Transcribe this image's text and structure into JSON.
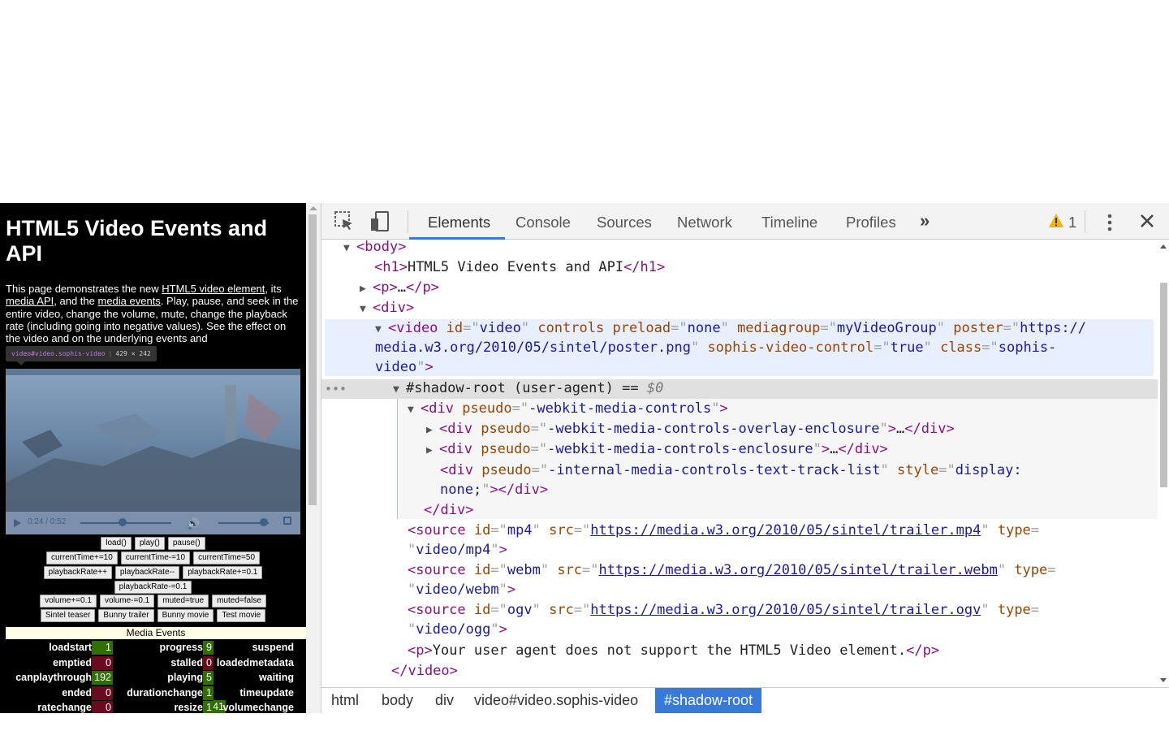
{
  "page": {
    "title": "HTML5 Video Events and API",
    "intro": {
      "t1": "This page demonstrates the new ",
      "link1": "HTML5 video element",
      "t2": ", its ",
      "link2": "media API",
      "t3": ", and the ",
      "link3": "media events",
      "t4": ". Play, pause, and seek in the entire video, change the volume, mute, change the playback rate (including going into negative values). See the effect on the video and on the underlying events and"
    },
    "tooltip": {
      "tag": "video#video.sophis-video",
      "size": "429 × 242"
    },
    "video": {
      "time": "0:24 / 0:52",
      "progress": 0.46,
      "volume": 0.9
    },
    "button_rows": [
      [
        "load()",
        "play()",
        "pause()"
      ],
      [
        "currentTime+=10",
        "currentTime-=10",
        "currentTime=50"
      ],
      [
        "playbackRate++",
        "playbackRate--",
        "playbackRate+=0.1"
      ],
      [
        "playbackRate-=0.1"
      ],
      [
        "volume+=0.1",
        "volume-=0.1",
        "muted=true",
        "muted=false"
      ],
      [
        "Sintel teaser",
        "Bunny trailer",
        "Bunny movie",
        "Test movie"
      ]
    ],
    "events_title": "Media Events",
    "events": [
      [
        {
          "name": "loadstart",
          "count": "1",
          "color": "#2f6f00"
        },
        {
          "name": "progress",
          "count": "9",
          "color": "#2f6f00"
        },
        {
          "name": "suspend",
          "count": "",
          "color": "#2f6f00"
        }
      ],
      [
        {
          "name": "emptied",
          "count": "0",
          "color": "#6a0a1f"
        },
        {
          "name": "stalled",
          "count": "0",
          "color": "#6a0a1f"
        },
        {
          "name": "loadedmetadata",
          "count": "",
          "color": "#2f6f00"
        }
      ],
      [
        {
          "name": "canplaythrough",
          "count": "192",
          "color": "#2f6f00"
        },
        {
          "name": "playing",
          "count": "5",
          "color": "#2f6f00"
        },
        {
          "name": "waiting",
          "count": "",
          "color": "#2f6f00"
        }
      ],
      [
        {
          "name": "ended",
          "count": "0",
          "color": "#6a0a1f"
        },
        {
          "name": "durationchange",
          "count": "1",
          "color": "#2f6f00"
        },
        {
          "name": "timeupdate",
          "count": "41",
          "color": "#2f6f00"
        }
      ],
      [
        {
          "name": "ratechange",
          "count": "0",
          "color": "#6a0a1f"
        },
        {
          "name": "resize",
          "count": "1",
          "color": "#2f6f00"
        },
        {
          "name": "volumechange",
          "count": "",
          "color": "#6a0a1f"
        }
      ]
    ]
  },
  "devtools": {
    "tabs": [
      "Elements",
      "Console",
      "Sources",
      "Network",
      "Timeline",
      "Profiles"
    ],
    "more_tabs": "»",
    "warning_count": "1",
    "tree": {
      "body": "body",
      "h1_text": "HTML5 Video Events and API",
      "p_ellipsis": "…",
      "video_attrs": {
        "id": "video",
        "preload": "none",
        "mediagroup": "myVideoGroup",
        "poster_a": "https://",
        "poster_b": "media.w3.org/2010/05/sintel/poster.png",
        "sophis": "true",
        "class_a": "sophis-",
        "class_b": "video"
      },
      "shadow_root": "#shadow-root (user-agent)",
      "shadow_eq": "== ",
      "shadow_var": "$0",
      "div_controls_pseudo": "-webkit-media-controls",
      "overlay_pseudo": "-webkit-media-controls-overlay-enclosure",
      "enclosure_pseudo": "-webkit-media-controls-enclosure",
      "text_track_pseudo": "-internal-media-controls-text-track-list",
      "text_track_style_a": "display:",
      "text_track_style_b": "none;",
      "sources": [
        {
          "id": "mp4",
          "src": "https://media.w3.org/2010/05/sintel/trailer.mp4",
          "type": "video/mp4"
        },
        {
          "id": "webm",
          "src": "https://media.w3.org/2010/05/sintel/trailer.webm",
          "type": "video/webm"
        },
        {
          "id": "ogv",
          "src": "https://media.w3.org/2010/05/sintel/trailer.ogv",
          "type": "video/ogg"
        }
      ],
      "fallback_text": "Your user agent does not support the HTML5 Video element."
    },
    "breadcrumbs": [
      "html",
      "body",
      "div",
      "video#video.sophis-video",
      "#shadow-root"
    ]
  },
  "colors": {
    "accent": "#3879d9",
    "tag": "#881280",
    "attr_name": "#994500",
    "attr_value": "#1a1aa6",
    "selection": "#e8efff"
  }
}
